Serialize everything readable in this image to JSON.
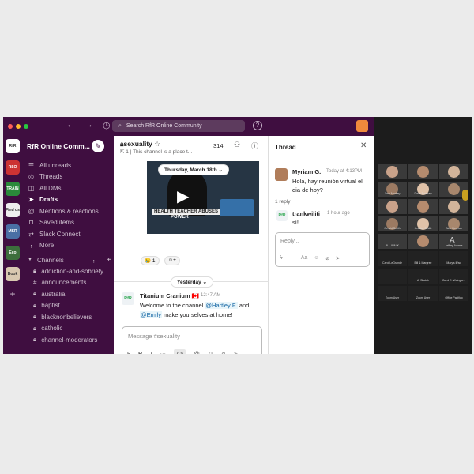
{
  "app": {
    "name": "Slack"
  },
  "search": {
    "placeholder": "Search RfR Online Community"
  },
  "workspace": {
    "name": "RfR Online Comm..."
  },
  "rail": {
    "items": [
      {
        "label": "RfR"
      },
      {
        "label": "RSO"
      },
      {
        "label": "TRAIN"
      },
      {
        "label": "Find us"
      },
      {
        "label": "MSR"
      },
      {
        "label": "Eco"
      },
      {
        "label": "Book"
      }
    ]
  },
  "sidebar": {
    "items": [
      {
        "label": "All unreads",
        "icon": "unreads-icon"
      },
      {
        "label": "Threads",
        "icon": "threads-icon"
      },
      {
        "label": "All DMs",
        "icon": "dms-icon"
      },
      {
        "label": "Drafts",
        "icon": "drafts-icon"
      },
      {
        "label": "Mentions & reactions",
        "icon": "at-icon"
      },
      {
        "label": "Saved items",
        "icon": "bookmark-icon"
      },
      {
        "label": "Slack Connect",
        "icon": "connect-icon"
      },
      {
        "label": "More",
        "icon": "more-icon"
      }
    ],
    "channels_label": "Channels",
    "channels": [
      "addiction-and-sobriety",
      "announcements",
      "australia",
      "baptist",
      "blacknonbelievers",
      "catholic",
      "channel-moderators"
    ]
  },
  "channel": {
    "name": "sexuality",
    "topic": "This channel is a place t...",
    "member_count": "314",
    "bookmark_count": "1"
  },
  "feed": {
    "date_pill": "Thursday, March 18th",
    "media_caption_1": "HEALTH TEACHER ABUSES",
    "media_caption_2": "POWER",
    "reaction_count": "1",
    "yesterday_label": "Yesterday",
    "message": {
      "author": "Titanium Cranium",
      "flag": "🇨🇦",
      "time": "12:47 AM",
      "text_1": "Welcome to the channel",
      "mention_1": "@Hartley F.",
      "text_2": "and",
      "mention_2": "@Emily",
      "text_3": "make yourselves at home!"
    }
  },
  "composer": {
    "placeholder": "Message #sexuality"
  },
  "thread": {
    "title": "Thread",
    "root": {
      "author": "Myriam G.",
      "time": "Today at 4:13PM",
      "text": "Hola, hay reunión virtual el dia de hoy?"
    },
    "replies_label": "1 reply",
    "reply": {
      "author": "trankwiliti",
      "time": "1 hour ago",
      "text": "sí!"
    },
    "reply_placeholder": "Reply..."
  },
  "video": {
    "tiles": [
      {
        "name": ""
      },
      {
        "name": ""
      },
      {
        "name": ""
      },
      {
        "name": "Josh Markey"
      },
      {
        "name": "Dave Ramsey"
      },
      {
        "name": ""
      },
      {
        "name": ""
      },
      {
        "name": ""
      },
      {
        "name": ""
      },
      {
        "name": "Gerald Smith"
      },
      {
        "name": "Jessica Smith"
      },
      {
        "name": "Alex Gorman"
      },
      {
        "name": "ALL WALK"
      },
      {
        "name": ""
      },
      {
        "name": "Jeffrey Adams"
      },
      {
        "name": "Carol LeGrande"
      },
      {
        "name": "Bill & Margree"
      },
      {
        "name": "Mary's iPad"
      },
      {
        "name": ""
      },
      {
        "name": "Al Shaleb"
      },
      {
        "name": "Carol E. Weingar..."
      },
      {
        "name": "Zoom User"
      },
      {
        "name": "Zoom User"
      },
      {
        "name": "Office Pacifico"
      }
    ]
  }
}
